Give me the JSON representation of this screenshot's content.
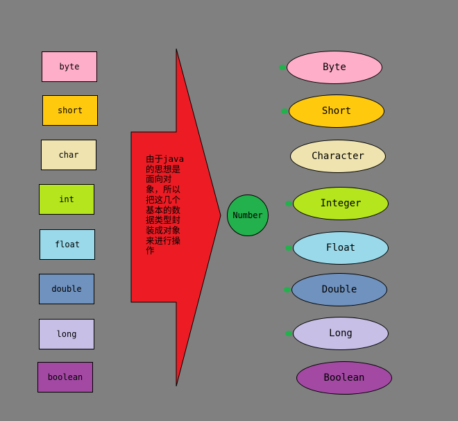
{
  "primitives": [
    {
      "label": "byte",
      "color": "#ffaec9"
    },
    {
      "label": "short",
      "color": "#ffc90e"
    },
    {
      "label": "char",
      "color": "#efe4b0"
    },
    {
      "label": "int",
      "color": "#b5e61d"
    },
    {
      "label": "float",
      "color": "#99d9ea"
    },
    {
      "label": "double",
      "color": "#7092be"
    },
    {
      "label": "long",
      "color": "#c8bfe7"
    },
    {
      "label": "boolean",
      "color": "#a349a4"
    }
  ],
  "arrow": {
    "text": "由于java的思想是面向对象，所以把这几个基本的数据类型封装成对象来进行操作",
    "color": "#ed1c24"
  },
  "number": {
    "label": "Number",
    "color": "#22b14c"
  },
  "wrappers": [
    {
      "label": "Byte",
      "color": "#ffaec9",
      "extends_number": true
    },
    {
      "label": "Short",
      "color": "#ffc90e",
      "extends_number": true
    },
    {
      "label": "Character",
      "color": "#efe4b0",
      "extends_number": false
    },
    {
      "label": "Integer",
      "color": "#b5e61d",
      "extends_number": true
    },
    {
      "label": "Float",
      "color": "#99d9ea",
      "extends_number": true
    },
    {
      "label": "Double",
      "color": "#7092be",
      "extends_number": true
    },
    {
      "label": "Long",
      "color": "#c8bfe7",
      "extends_number": true
    },
    {
      "label": "Boolean",
      "color": "#a349a4",
      "extends_number": false
    }
  ]
}
